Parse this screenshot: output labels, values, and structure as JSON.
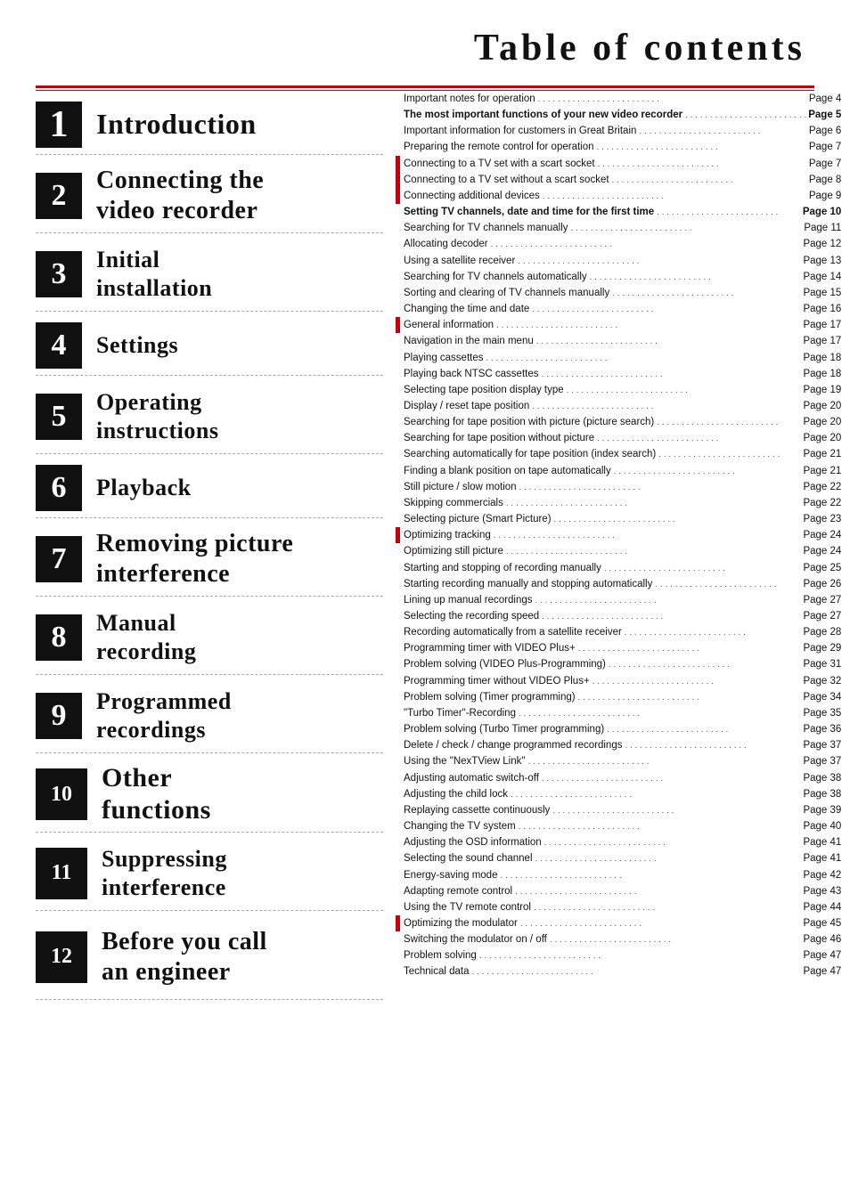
{
  "title": "Table of contents",
  "chapters": [
    {
      "num": "1",
      "title": "Introduction",
      "lines": 1
    },
    {
      "num": "2",
      "title": "Connecting the\nvideo recorder",
      "lines": 2
    },
    {
      "num": "3",
      "title": "Initial\ninstallation",
      "lines": 2
    },
    {
      "num": "4",
      "title": "Settings",
      "lines": 1
    },
    {
      "num": "5",
      "title": "Operating\ninstructions",
      "lines": 2
    },
    {
      "num": "6",
      "title": "Playback",
      "lines": 1
    },
    {
      "num": "7",
      "title": "Removing picture\ninterference",
      "lines": 2
    },
    {
      "num": "8",
      "title": "Manual\nrecording",
      "lines": 2
    },
    {
      "num": "9",
      "title": "Programmed\nrecordings",
      "lines": 2
    },
    {
      "num": "10",
      "title": "Other\nfunctions",
      "lines": 2
    },
    {
      "num": "11",
      "title": "Suppressing\ninterference",
      "lines": 2
    },
    {
      "num": "12",
      "title": "Before you call\nan engineer",
      "lines": 2
    }
  ],
  "toc_entries": [
    {
      "text": "Important notes for operation",
      "dots": true,
      "page": "Page 4",
      "bold": false,
      "red_bar": false
    },
    {
      "text": "The most important functions of your new video recorder",
      "dots": true,
      "page": "Page 5",
      "bold": true,
      "red_bar": false
    },
    {
      "text": "Important information for customers in Great Britain",
      "dots": true,
      "page": "Page 6",
      "bold": false,
      "red_bar": false
    },
    {
      "text": "Preparing the remote control for operation",
      "dots": true,
      "page": "Page 7",
      "bold": false,
      "red_bar": false
    },
    {
      "text": "Connecting to a TV set with a scart socket",
      "dots": true,
      "page": "Page 7",
      "bold": false,
      "red_bar": true
    },
    {
      "text": "Connecting to a TV set without a scart socket",
      "dots": true,
      "page": "Page 8",
      "bold": false,
      "red_bar": true
    },
    {
      "text": "Connecting additional devices",
      "dots": true,
      "page": "Page 9",
      "bold": false,
      "red_bar": true
    },
    {
      "text": "Setting TV channels, date and time for the first time",
      "dots": true,
      "page": "Page 10",
      "bold": true,
      "red_bar": false
    },
    {
      "text": "Searching for TV channels manually",
      "dots": true,
      "page": "Page 11",
      "bold": false,
      "red_bar": false
    },
    {
      "text": "Allocating decoder",
      "dots": true,
      "page": "Page 12",
      "bold": false,
      "red_bar": false
    },
    {
      "text": "Using a satellite receiver",
      "dots": true,
      "page": "Page 13",
      "bold": false,
      "red_bar": false
    },
    {
      "text": "Searching for TV channels automatically",
      "dots": true,
      "page": "Page 14",
      "bold": false,
      "red_bar": false
    },
    {
      "text": "Sorting and clearing of TV channels manually",
      "dots": true,
      "page": "Page 15",
      "bold": false,
      "red_bar": false
    },
    {
      "text": "Changing the time and date",
      "dots": true,
      "page": "Page 16",
      "bold": false,
      "red_bar": false
    },
    {
      "text": "General information",
      "dots": true,
      "page": "Page 17",
      "bold": false,
      "red_bar": true
    },
    {
      "text": "Navigation in the main menu",
      "dots": true,
      "page": "Page 17",
      "bold": false,
      "red_bar": false
    },
    {
      "text": "Playing cassettes",
      "dots": true,
      "page": "Page 18",
      "bold": false,
      "red_bar": false
    },
    {
      "text": "Playing back NTSC cassettes",
      "dots": true,
      "page": "Page 18",
      "bold": false,
      "red_bar": false
    },
    {
      "text": "Selecting tape position display type",
      "dots": true,
      "page": "Page 19",
      "bold": false,
      "red_bar": false
    },
    {
      "text": "Display / reset tape position",
      "dots": true,
      "page": "Page 20",
      "bold": false,
      "red_bar": false
    },
    {
      "text": "Searching for tape position with picture (picture search)",
      "dots": true,
      "page": "Page 20",
      "bold": false,
      "red_bar": false
    },
    {
      "text": "Searching for tape position without picture",
      "dots": true,
      "page": "Page 20",
      "bold": false,
      "red_bar": false
    },
    {
      "text": "Searching automatically for tape position (index search)",
      "dots": true,
      "page": "Page 21",
      "bold": false,
      "red_bar": false
    },
    {
      "text": "Finding a blank position on tape automatically",
      "dots": true,
      "page": "Page 21",
      "bold": false,
      "red_bar": false
    },
    {
      "text": "Still picture / slow motion",
      "dots": true,
      "page": "Page 22",
      "bold": false,
      "red_bar": false
    },
    {
      "text": "Skipping commercials",
      "dots": true,
      "page": "Page 22",
      "bold": false,
      "red_bar": false
    },
    {
      "text": "Selecting picture (Smart Picture)",
      "dots": true,
      "page": "Page 23",
      "bold": false,
      "red_bar": false
    },
    {
      "text": "Optimizing tracking",
      "dots": true,
      "page": "Page 24",
      "bold": false,
      "red_bar": true
    },
    {
      "text": "Optimizing still picture",
      "dots": true,
      "page": "Page 24",
      "bold": false,
      "red_bar": false
    },
    {
      "text": "Starting and stopping of recording manually",
      "dots": true,
      "page": "Page 25",
      "bold": false,
      "red_bar": false
    },
    {
      "text": "Starting recording manually and stopping automatically",
      "dots": true,
      "page": "Page 26",
      "bold": false,
      "red_bar": false
    },
    {
      "text": "Lining up manual recordings",
      "dots": true,
      "page": "Page 27",
      "bold": false,
      "red_bar": false
    },
    {
      "text": "Selecting the recording speed",
      "dots": true,
      "page": "Page 27",
      "bold": false,
      "red_bar": false
    },
    {
      "text": "Recording automatically from a satellite receiver",
      "dots": true,
      "page": "Page 28",
      "bold": false,
      "red_bar": false
    },
    {
      "text": "Programming timer with VIDEO Plus+",
      "dots": true,
      "page": "Page 29",
      "bold": false,
      "red_bar": false
    },
    {
      "text": "Problem solving (VIDEO Plus-Programming)",
      "dots": true,
      "page": "Page 31",
      "bold": false,
      "red_bar": false
    },
    {
      "text": "Programming timer without VIDEO Plus+",
      "dots": true,
      "page": "Page 32",
      "bold": false,
      "red_bar": false
    },
    {
      "text": "Problem solving (Timer programming)",
      "dots": true,
      "page": "Page 34",
      "bold": false,
      "red_bar": false
    },
    {
      "text": "\"Turbo Timer\"-Recording",
      "dots": true,
      "page": "Page 35",
      "bold": false,
      "red_bar": false
    },
    {
      "text": "Problem solving (Turbo Timer programming)",
      "dots": true,
      "page": "Page 36",
      "bold": false,
      "red_bar": false
    },
    {
      "text": "Delete / check / change programmed recordings",
      "dots": true,
      "page": "Page 37",
      "bold": false,
      "red_bar": false
    },
    {
      "text": "Using the \"NexTView Link\"",
      "dots": true,
      "page": "Page 37",
      "bold": false,
      "red_bar": false
    },
    {
      "text": "Adjusting automatic switch-off",
      "dots": true,
      "page": "Page 38",
      "bold": false,
      "red_bar": false
    },
    {
      "text": "Adjusting the child lock",
      "dots": true,
      "page": "Page 38",
      "bold": false,
      "red_bar": false
    },
    {
      "text": "Replaying cassette continuously",
      "dots": true,
      "page": "Page 39",
      "bold": false,
      "red_bar": false
    },
    {
      "text": "Changing the TV system",
      "dots": true,
      "page": "Page 40",
      "bold": false,
      "red_bar": false
    },
    {
      "text": "Adjusting the OSD information",
      "dots": true,
      "page": "Page 41",
      "bold": false,
      "red_bar": false
    },
    {
      "text": "Selecting the sound channel",
      "dots": true,
      "page": "Page 41",
      "bold": false,
      "red_bar": false
    },
    {
      "text": "Energy-saving mode",
      "dots": true,
      "page": "Page 42",
      "bold": false,
      "red_bar": false
    },
    {
      "text": "Adapting remote control",
      "dots": true,
      "page": "Page 43",
      "bold": false,
      "red_bar": false
    },
    {
      "text": "Using the TV remote control",
      "dots": true,
      "page": "Page 44",
      "bold": false,
      "red_bar": false
    },
    {
      "text": "Optimizing the modulator",
      "dots": true,
      "page": "Page 45",
      "bold": false,
      "red_bar": true
    },
    {
      "text": "Switching the modulator on / off",
      "dots": true,
      "page": "Page 46",
      "bold": false,
      "red_bar": false
    },
    {
      "text": "Problem solving",
      "dots": true,
      "page": "Page 47",
      "bold": false,
      "red_bar": false
    },
    {
      "text": "Technical data",
      "dots": true,
      "page": "Page 47",
      "bold": false,
      "red_bar": false
    }
  ]
}
